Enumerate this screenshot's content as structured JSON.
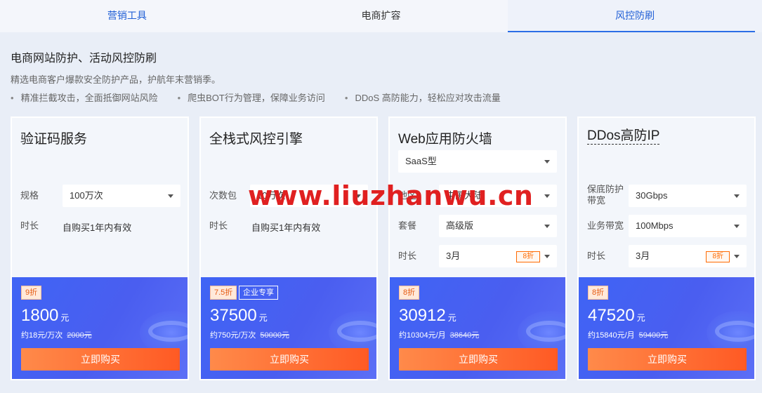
{
  "tabs": [
    "营销工具",
    "电商扩容",
    "风控防刷"
  ],
  "heading": "电商网站防护、活动风控防刷",
  "description": "精选电商客户爆款安全防护产品，护航年末营销季。",
  "bullets": [
    "精准拦截攻击，全面抵御网站风险",
    "爬虫BOT行为管理，保障业务访问",
    "DDoS 高防能力，轻松应对攻击流量"
  ],
  "watermark": "www.liuzhanwu.cn",
  "cards": [
    {
      "title": "验证码服务",
      "rows": [
        {
          "label": "规格",
          "value": "100万次"
        },
        {
          "label": "时长",
          "value": "自购买1年内有效"
        }
      ],
      "badges": [
        "9折"
      ],
      "price": "1800",
      "price_unit": "元",
      "unit_price": "约18元/万次",
      "original_price": "2000元",
      "buy_label": "立即购买"
    },
    {
      "title": "全栈式风控引擎",
      "rows": [
        {
          "label": "次数包",
          "value": "10万次"
        },
        {
          "label": "时长",
          "value": "自购买1年内有效"
        }
      ],
      "badges": [
        "7.5折",
        "企业专享"
      ],
      "price": "37500",
      "price_unit": "元",
      "unit_price": "约750元/万次",
      "original_price": "50000元",
      "buy_label": "立即购买"
    },
    {
      "title": "Web应用防火墙",
      "type_select": "SaaS型",
      "rows": [
        {
          "label": "地区",
          "value": "中国大陆"
        },
        {
          "label": "套餐",
          "value": "高级版"
        },
        {
          "label": "时长",
          "value": "3月",
          "discount": "8折"
        }
      ],
      "badges": [
        "8折"
      ],
      "price": "30912",
      "price_unit": "元",
      "unit_price": "约10304元/月",
      "original_price": "38640元",
      "buy_label": "立即购买"
    },
    {
      "title": "DDos高防IP",
      "rows": [
        {
          "label": "保底防护带宽",
          "value": "30Gbps"
        },
        {
          "label": "业务带宽",
          "value": "100Mbps"
        },
        {
          "label": "时长",
          "value": "3月",
          "discount": "8折"
        }
      ],
      "badges": [
        "8折"
      ],
      "price": "47520",
      "price_unit": "元",
      "unit_price": "约15840元/月",
      "original_price": "59400元",
      "buy_label": "立即购买"
    }
  ]
}
